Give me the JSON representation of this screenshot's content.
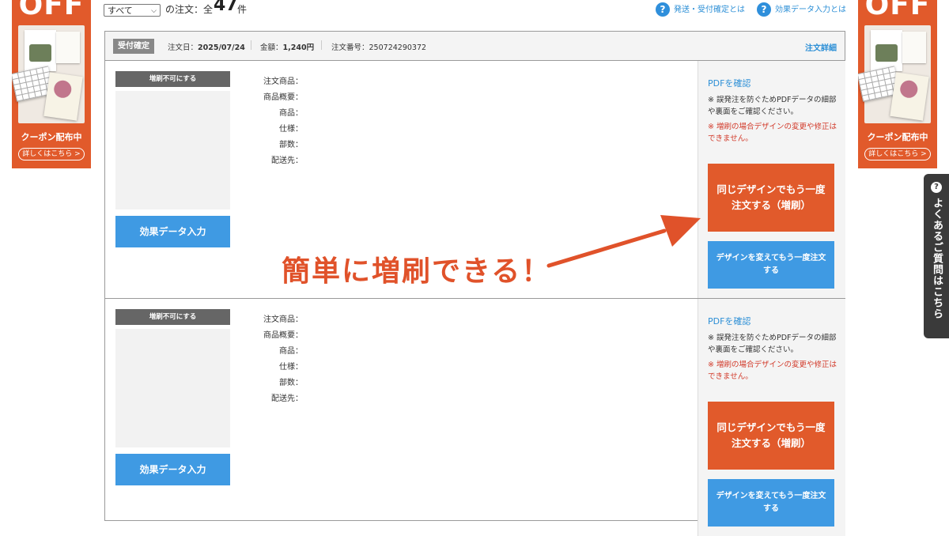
{
  "banners": {
    "off_text": "OFF",
    "coupon_label": "クーポン配布中",
    "detail_label": "詳しくはこちら >"
  },
  "faq_tab": {
    "icon": "?",
    "label": "よくあるご質問はこちら"
  },
  "toolbar": {
    "filter_value": "すべて",
    "order_count_label": "の注文：全",
    "order_count": "47",
    "order_count_unit": "件",
    "help_links": [
      "発送・受付確定とは",
      "効果データ入力とは"
    ]
  },
  "orders": [
    {
      "status": "受付確定",
      "order_date_label": "注文日：",
      "order_date": "2025/07/24",
      "amount_label": "金額：",
      "amount": "1,240円",
      "order_number_label": "注文番号：",
      "order_number": "250724290372",
      "detail_link": "注文詳細",
      "thumb_caption": "増刷不可にする",
      "effect_button": "効果データ入力",
      "fields": [
        "注文商品：",
        "商品概要：",
        "商品：",
        "仕様：",
        "部数：",
        "配送先："
      ],
      "pdf_link": "PDFを確認",
      "note": "※ 誤発注を防ぐためPDFデータの細部や裏面をご確認ください。",
      "warning": "※ 増刷の場合デザインの変更や修正はできません。",
      "reorder_button_line1": "同じデザインでもう一度",
      "reorder_button_line2": "注文する（増刷）",
      "redesign_button_line1": "デザインを変えてもう一度注文",
      "redesign_button_line2": "する"
    },
    {
      "thumb_caption": "増刷不可にする",
      "effect_button": "効果データ入力",
      "fields": [
        "注文商品：",
        "商品概要：",
        "商品：",
        "仕様：",
        "部数：",
        "配送先："
      ],
      "pdf_link": "PDFを確認",
      "note": "※ 誤発注を防ぐためPDFデータの細部や裏面をご確認ください。",
      "warning": "※ 増刷の場合デザインの変更や修正はできません。",
      "reorder_button_line1": "同じデザインでもう一度",
      "reorder_button_line2": "注文する（増刷）",
      "redesign_button_line1": "デザインを変えてもう一度注文",
      "redesign_button_line2": "する"
    }
  ],
  "annotation": {
    "text": "簡単に増刷できる！",
    "color": "#e0522a"
  },
  "colors": {
    "accent_orange": "#e15a2b",
    "accent_blue": "#3f9ae3",
    "link_blue": "#2c8fd6",
    "warning_red": "#d23a2a"
  }
}
